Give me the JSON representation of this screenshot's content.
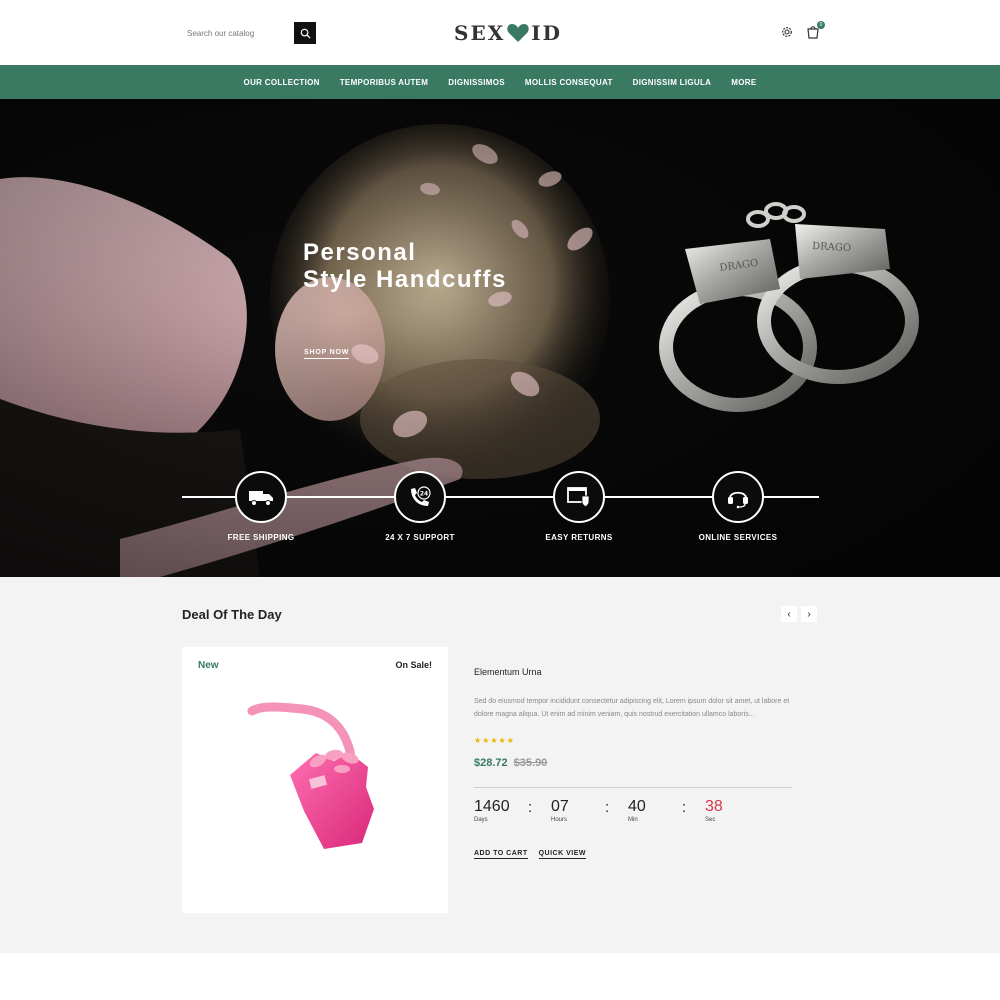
{
  "header": {
    "search_placeholder": "Search our catalog",
    "logo_left": "SEX",
    "logo_right": "ID",
    "cart_count": "0",
    "icons": [
      "search-icon",
      "heart-icon",
      "gear-icon",
      "shopping-bag-icon"
    ]
  },
  "nav": {
    "items": [
      "OUR COLLECTION",
      "TEMPORIBUS AUTEM",
      "DIGNISSIMOS",
      "MOLLIS CONSEQUAT",
      "DIGNISSIM LIGULA",
      "MORE"
    ]
  },
  "hero": {
    "title_line1": "Personal",
    "title_line2": "Style Handcuffs",
    "cta": "SHOP NOW",
    "features": [
      {
        "label": "FREE SHIPPING",
        "icon": "truck-icon"
      },
      {
        "label": "24 X 7 SUPPORT",
        "icon": "phone-24-icon"
      },
      {
        "label": "EASY RETURNS",
        "icon": "return-shield-icon"
      },
      {
        "label": "ONLINE SERVICES",
        "icon": "headset-icon"
      }
    ],
    "handcuff_engraving": "DRAGO"
  },
  "deal": {
    "title": "Deal Of The Day",
    "prev_arrow": "‹",
    "next_arrow": "›",
    "product": {
      "badge_new": "New",
      "badge_sale": "On Sale!",
      "name": "Elementum Urna",
      "description": "Sed do eiusmod tempor incididunt consectetur adipiscing elit, Lorem ipsum dolor sit amet, ut labore et dolore magna aliqua. Ut enim ad minim veniam, quis nostrud exercitation ullamco laboris...",
      "rating": 5,
      "stars": "★★★★★",
      "price": "$28.72",
      "old_price": "$35.90"
    },
    "countdown": {
      "days": "1460",
      "days_label": "Days",
      "hours": "07",
      "hours_label": "Hours",
      "min": "40",
      "min_label": "Min",
      "sec": "38",
      "sec_label": "Sec",
      "separator": ":"
    },
    "add_to_cart": "ADD TO CART",
    "quick_view": "QUICK VIEW"
  },
  "colors": {
    "brand_green": "#3a7a63",
    "countdown_red": "#d9364a",
    "star_gold": "#f0b400"
  }
}
